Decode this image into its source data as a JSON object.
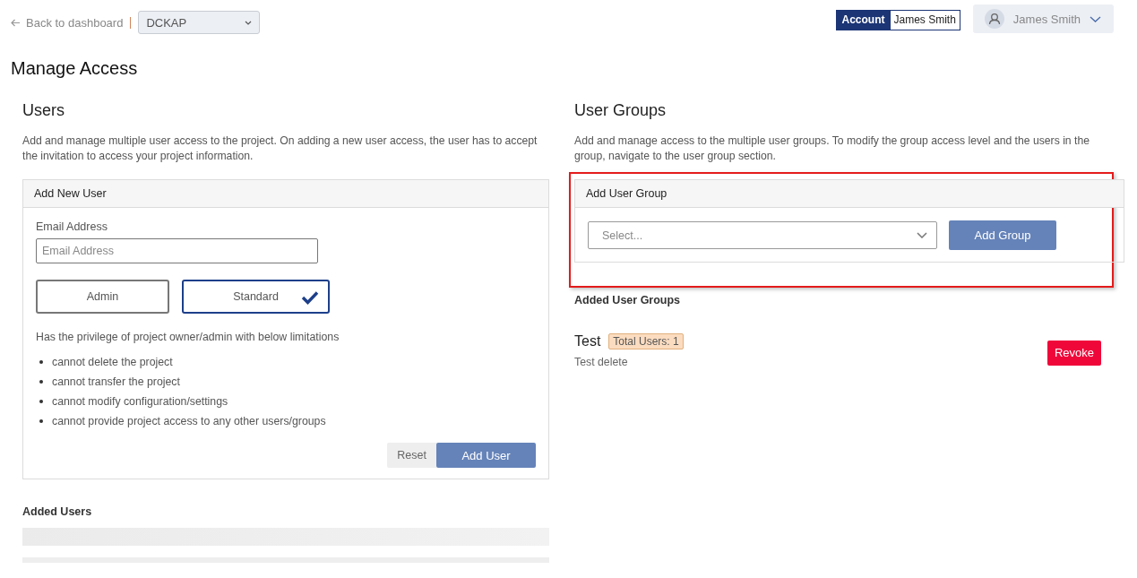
{
  "header": {
    "back_link": "Back to dashboard",
    "project_select": {
      "value": "DCKAP"
    },
    "account_badge": {
      "label": "Account",
      "name": "James Smith"
    },
    "user_menu": {
      "name": "James Smith"
    }
  },
  "title": "Manage Access",
  "users": {
    "heading": "Users",
    "description": "Add and manage multiple user access to the project. On adding a new user access, the user has to accept the invitation to access your project information.",
    "card": {
      "title": "Add New User",
      "email_label": "Email Address",
      "email_placeholder": "Email Address",
      "roles": [
        {
          "label": "Admin",
          "selected": false
        },
        {
          "label": "Standard",
          "selected": true
        }
      ],
      "privilege_note": "Has the privilege of project owner/admin with below limitations",
      "limitations": [
        "cannot delete the project",
        "cannot transfer the project",
        "cannot modify configuration/settings",
        "cannot provide project access to any other users/groups"
      ],
      "buttons": {
        "reset": "Reset",
        "add": "Add User"
      }
    },
    "added_heading": "Added Users"
  },
  "groups": {
    "heading": "User Groups",
    "description": "Add and manage access to the multiple user groups. To modify the group access level and the users in the group, navigate to the user group section.",
    "card": {
      "title": "Add User Group",
      "select_placeholder": "Select...",
      "add": "Add Group"
    },
    "added_heading": "Added User Groups",
    "items": [
      {
        "name": "Test",
        "badge": "Total Users: 1",
        "description": "Test delete",
        "action": "Revoke"
      }
    ]
  }
}
